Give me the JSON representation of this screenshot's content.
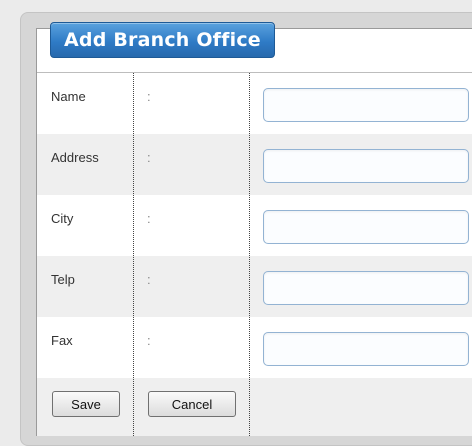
{
  "form": {
    "title": "Add Branch Office",
    "separator": ":",
    "fields": [
      {
        "label": "Name",
        "value": ""
      },
      {
        "label": "Address",
        "value": ""
      },
      {
        "label": "City",
        "value": ""
      },
      {
        "label": "Telp",
        "value": ""
      },
      {
        "label": "Fax",
        "value": ""
      }
    ]
  },
  "actions": {
    "save_label": "Save",
    "cancel_label": "Cancel"
  },
  "colors": {
    "title_tab": "#2f7bc6",
    "input_border": "#93b3d3",
    "alt_row": "#efefef"
  }
}
